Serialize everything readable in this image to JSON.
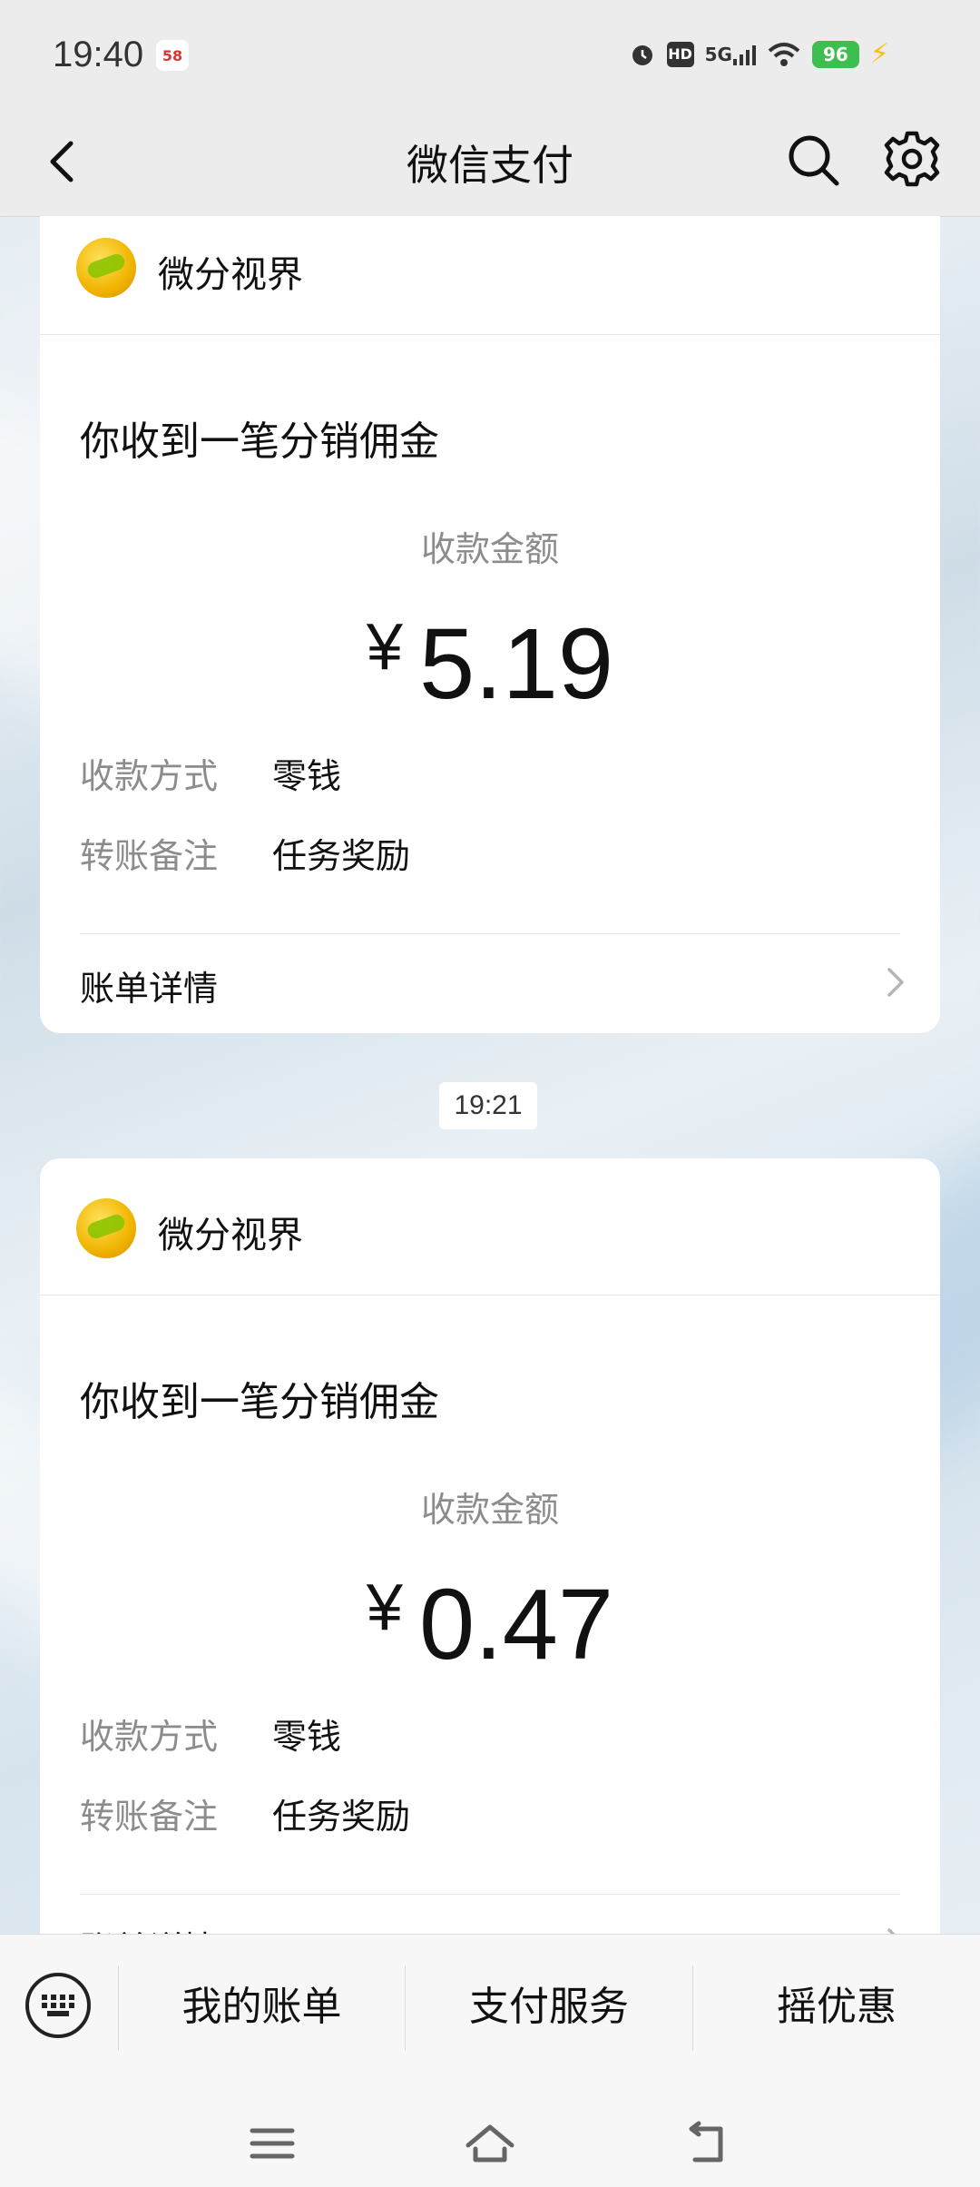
{
  "status_bar": {
    "time": "19:40",
    "app_badge": "58",
    "network": "5G",
    "hd": "HD",
    "battery": "96"
  },
  "nav": {
    "title": "微信支付"
  },
  "cards": [
    {
      "merchant": "微分视界",
      "title": "你收到一笔分销佣金",
      "amount_label": "收款金额",
      "currency": "¥",
      "amount": "5.19",
      "rows": [
        {
          "label": "收款方式",
          "value": "零钱"
        },
        {
          "label": "转账备注",
          "value": "任务奖励"
        }
      ],
      "detail_label": "账单详情"
    },
    {
      "merchant": "微分视界",
      "title": "你收到一笔分销佣金",
      "amount_label": "收款金额",
      "currency": "¥",
      "amount": "0.47",
      "rows": [
        {
          "label": "收款方式",
          "value": "零钱"
        },
        {
          "label": "转账备注",
          "value": "任务奖励"
        }
      ],
      "detail_label": "账单详情"
    }
  ],
  "timestamp": "19:21",
  "bottom_menu": {
    "items": [
      "我的账单",
      "支付服务",
      "摇优惠"
    ]
  },
  "colors": {
    "battery": "#3cbf4e",
    "accent_text": "#111111",
    "muted_text": "#8c8c8c"
  }
}
